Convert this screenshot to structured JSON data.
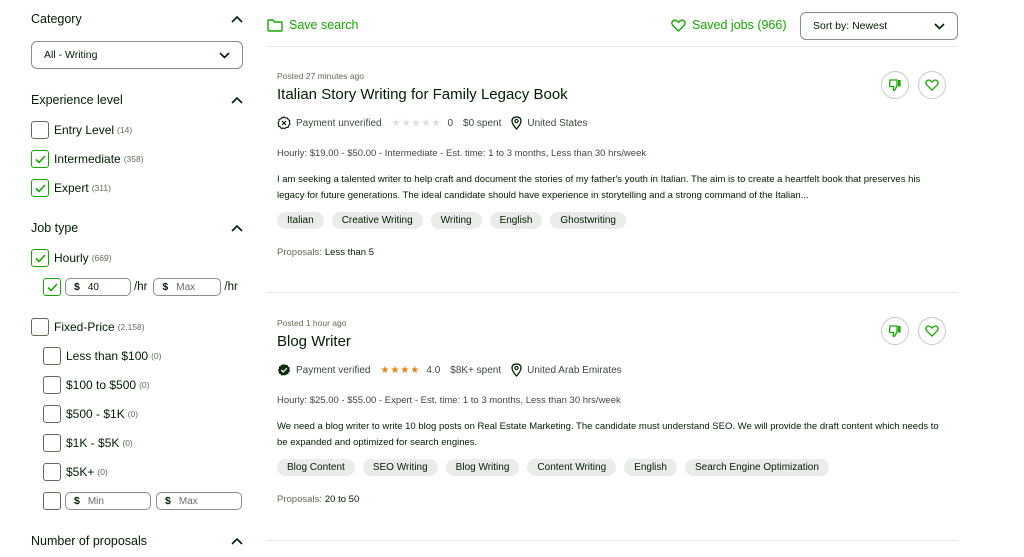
{
  "sidebar": {
    "category": {
      "heading": "Category",
      "selected": "All - Writing"
    },
    "experience": {
      "heading": "Experience level",
      "options": [
        {
          "label": "Entry Level",
          "count": "(14)",
          "checked": false
        },
        {
          "label": "Intermediate",
          "count": "(358)",
          "checked": true
        },
        {
          "label": "Expert",
          "count": "(311)",
          "checked": true
        }
      ]
    },
    "job_type": {
      "heading": "Job type",
      "hourly": {
        "label": "Hourly",
        "count": "(669)",
        "checked": true
      },
      "hourly_rate": {
        "min_symbol": "$",
        "min_value": "40",
        "min_suffix": "/hr",
        "max_symbol": "$",
        "max_placeholder": "Max",
        "max_suffix": "/hr"
      },
      "fixed": {
        "label": "Fixed-Price",
        "count": "(2,158)",
        "checked": false
      },
      "fixed_options": [
        {
          "label": "Less than $100",
          "count": "(0)"
        },
        {
          "label": "$100 to $500",
          "count": "(0)"
        },
        {
          "label": "$500 - $1K",
          "count": "(0)"
        },
        {
          "label": "$1K - $5K",
          "count": "(0)"
        },
        {
          "label": "$5K+",
          "count": "(0)"
        }
      ],
      "fixed_range": {
        "min_symbol": "$",
        "min_placeholder": "Min",
        "max_symbol": "$",
        "max_placeholder": "Max"
      }
    },
    "proposals": {
      "heading": "Number of proposals"
    }
  },
  "topbar": {
    "save_search": "Save search",
    "saved_jobs": "Saved jobs (966)",
    "sort": "Sort by: Newest"
  },
  "jobs": [
    {
      "posted": "Posted 27 minutes ago",
      "title": "Italian Story Writing for Family Legacy Book",
      "payment": "Payment unverified",
      "rating": "0",
      "rating_stars": 0,
      "spent": "$0 spent",
      "location": "United States",
      "detail": "Hourly: $19.00 - $50.00 - Intermediate - Est. time: 1 to 3 months, Less than 30 hrs/week",
      "desc": "I am seeking a talented writer to help craft and document the stories of my father's youth in Italian. The aim is to create a heartfelt book that preserves his legacy for future generations. The ideal candidate should have experience in storytelling and a strong command of the Italian...",
      "tags": [
        "Italian",
        "Creative Writing",
        "Writing",
        "English",
        "Ghostwriting"
      ],
      "proposals_label": "Proposals:",
      "proposals_value": "Less than 5"
    },
    {
      "posted": "Posted 1 hour ago",
      "title": "Blog Writer",
      "payment": "Payment verified",
      "rating": "4.0",
      "rating_stars": 4,
      "spent": "$8K+ spent",
      "location": "United Arab Emirates",
      "detail": "Hourly: $25.00 - $55.00 - Expert - Est. time: 1 to 3 months, Less than 30 hrs/week",
      "desc": "We need a blog writer to write 10 blog posts on Real Estate Marketing. The candidate must understand SEO. We will provide the draft content which needs to be expanded and optimized for search engines.",
      "tags": [
        "Blog Content",
        "SEO Writing",
        "Blog Writing",
        "Content Writing",
        "English",
        "Search Engine Optimization"
      ],
      "proposals_label": "Proposals:",
      "proposals_value": "20 to 50"
    }
  ],
  "colors": {
    "accent": "#14a800",
    "text": "#001e00",
    "muted": "#5e6d55",
    "star": "#e5810f",
    "tag_bg": "#e9ece9"
  }
}
